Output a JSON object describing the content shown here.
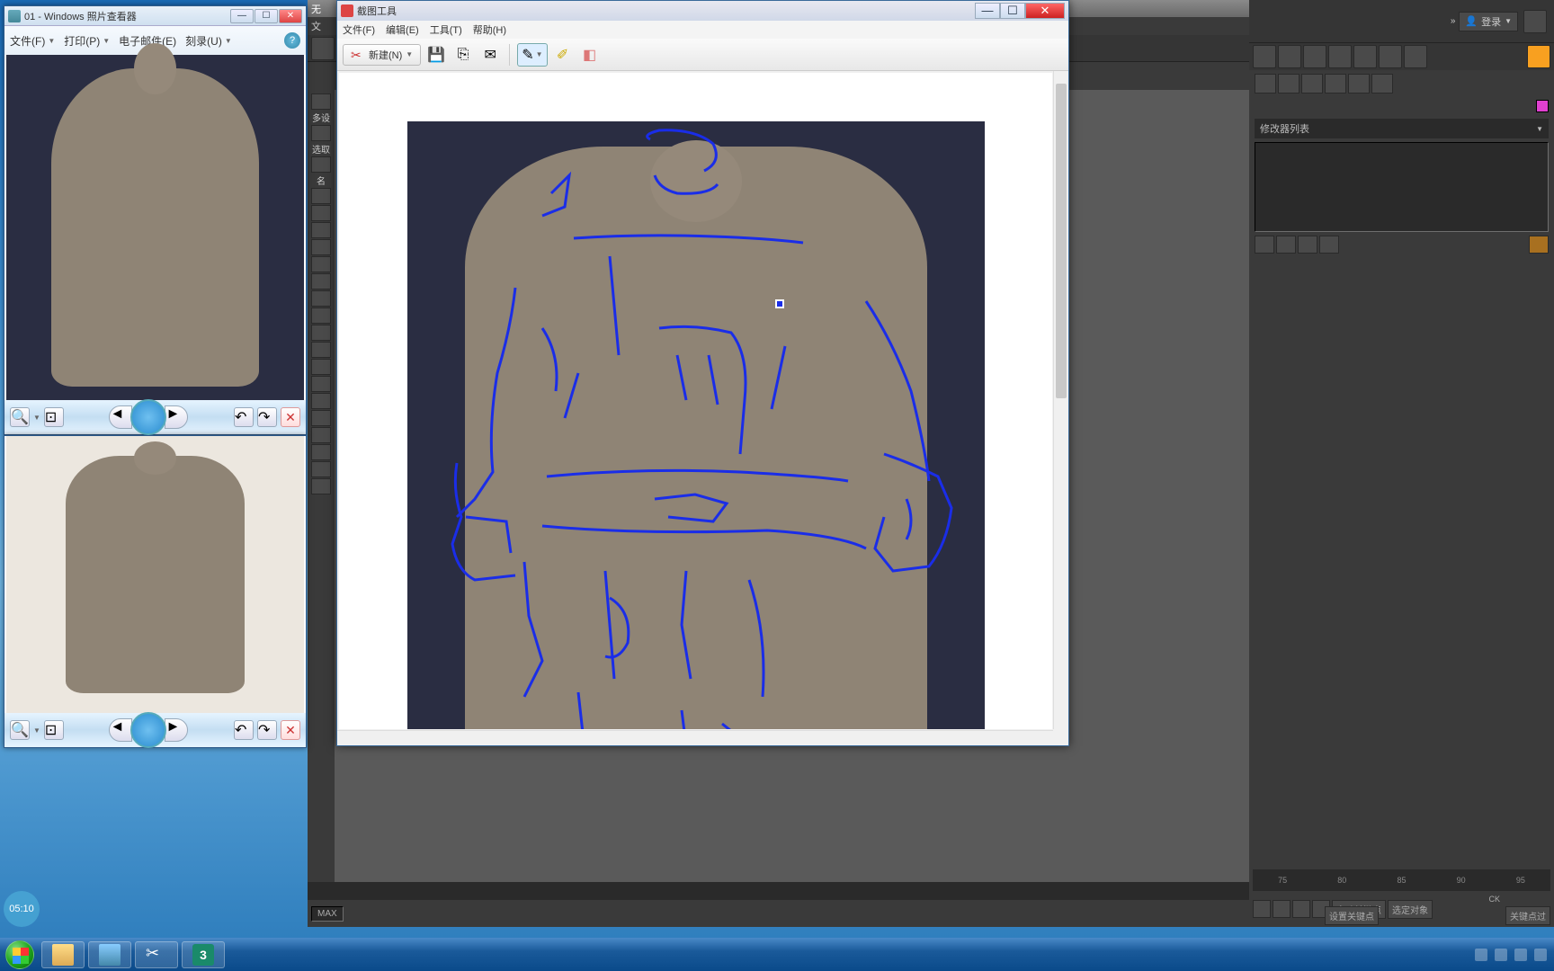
{
  "photo_viewer": {
    "title": "01 - Windows 照片查看器",
    "menu": {
      "file": "文件(F)",
      "print": "打印(P)",
      "email": "电子邮件(E)",
      "burn": "刻录(U)"
    },
    "controls": {
      "min": "—",
      "max": "☐",
      "close": "✕",
      "zoom_out": "–",
      "zoom_in": "+",
      "actual": "⊡",
      "prev": "◄",
      "play": "▶",
      "next": "►",
      "rotate_ccw": "↶",
      "rotate_cw": "↷",
      "delete": "✕"
    }
  },
  "snip": {
    "title": "截图工具",
    "menu": {
      "file": "文件(F)",
      "edit": "编辑(E)",
      "tools": "工具(T)",
      "help": "帮助(H)"
    },
    "toolbar": {
      "new": "新建(N)",
      "save": "💾",
      "copy": "⎘",
      "mail": "✉",
      "pen": "✎",
      "highlight": "✐",
      "erase": "◧"
    },
    "controls": {
      "min": "—",
      "max": "☐",
      "close": "✕"
    }
  },
  "max3d": {
    "title": "无",
    "menu_partial": "文",
    "side_labels": [
      "多设",
      "选取",
      "名"
    ],
    "login": "登录",
    "modifier_label": "修改器列表",
    "maxscript": "MAX",
    "timeline_ticks": [
      "75",
      "80",
      "85",
      "90",
      "95"
    ],
    "bottom": {
      "autokey": "自动关键点",
      "selobj": "选定对象",
      "setkey": "设置关键点",
      "keyfilter": "关键点过",
      "ck": "CK"
    }
  },
  "taskbar": {
    "items": [
      "explorer",
      "pictures",
      "snipping-tool",
      "3dsmax"
    ],
    "max_label": "3",
    "ime": "⌨",
    "ime2": "⊞"
  },
  "video": {
    "timestamp": "05:10"
  }
}
